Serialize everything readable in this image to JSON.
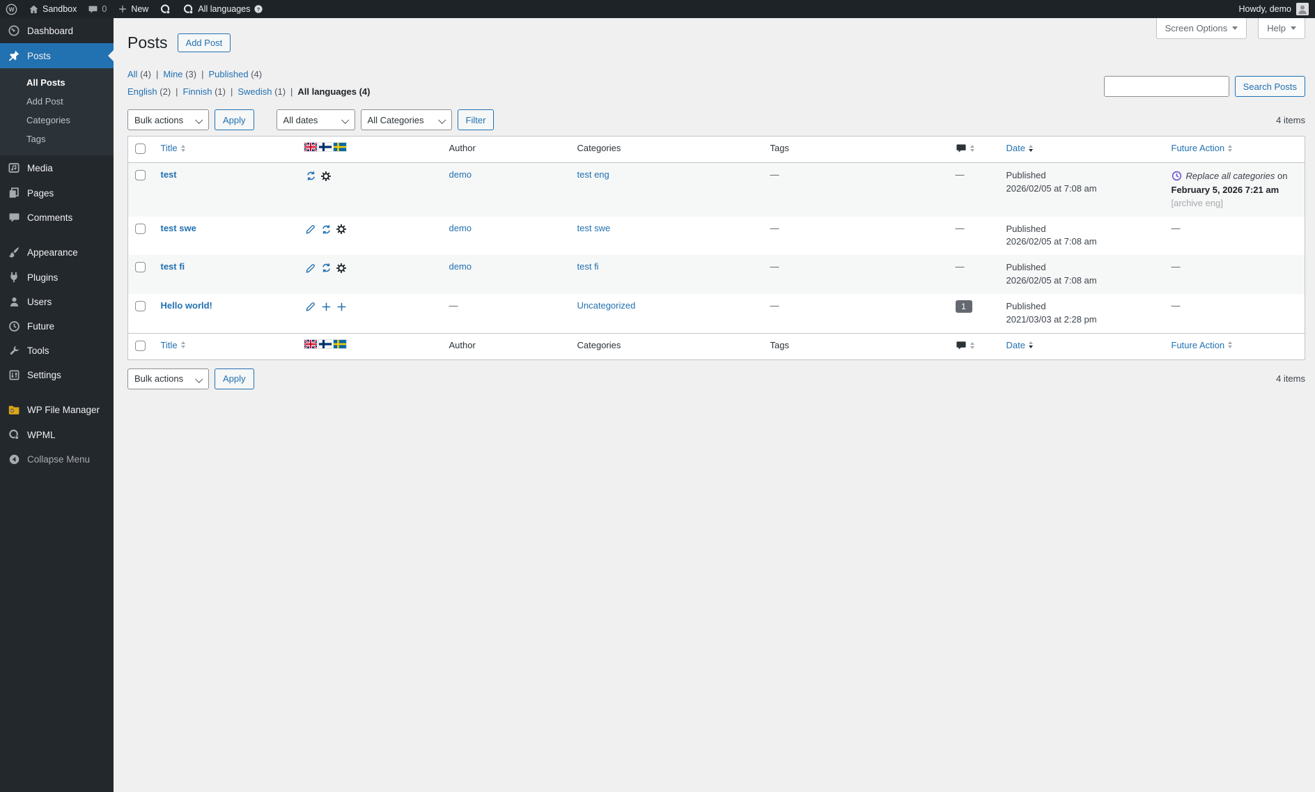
{
  "colors": {
    "admin_bar_bg": "#1d2327",
    "sidebar_bg": "#23282d",
    "submenu_bg": "#2c3338",
    "accent": "#2271b1",
    "page_bg": "#f0f0f1",
    "stripe": "#f6f7f7",
    "table_border": "#c3c4c7",
    "future_clock": "#6e56cf",
    "folder_orange": "#dba617"
  },
  "admin_bar": {
    "site_name": "Sandbox",
    "comment_count": "0",
    "new_label": "New",
    "language_selector": "All languages",
    "howdy": "Howdy, demo",
    "icons": [
      "wordpress-logo",
      "home-icon",
      "comments-bubble-icon",
      "plus-icon",
      "wpml-icon",
      "wpml-icon",
      "help-icon",
      "avatar"
    ]
  },
  "sidebar": {
    "items": [
      {
        "label": "Dashboard",
        "icon": "dashboard-gauge-icon"
      },
      {
        "label": "Posts",
        "icon": "pushpin-icon",
        "active": true,
        "submenu": [
          "All Posts",
          "Add Post",
          "Categories",
          "Tags"
        ],
        "current_submenu": "All Posts"
      },
      {
        "label": "Media",
        "icon": "media-icon"
      },
      {
        "label": "Pages",
        "icon": "pages-icon"
      },
      {
        "label": "Comments",
        "icon": "comment-bubble-icon"
      },
      {
        "label": "Appearance",
        "icon": "paintbrush-icon"
      },
      {
        "label": "Plugins",
        "icon": "plug-icon"
      },
      {
        "label": "Users",
        "icon": "person-icon"
      },
      {
        "label": "Future",
        "icon": "clock-icon"
      },
      {
        "label": "Tools",
        "icon": "wrench-icon"
      },
      {
        "label": "Settings",
        "icon": "sliders-icon"
      },
      {
        "label": "WP File Manager",
        "icon": "folder-icon"
      },
      {
        "label": "WPML",
        "icon": "wpml-globe-icon"
      },
      {
        "label": "Collapse Menu",
        "icon": "collapse-arrow-icon"
      }
    ]
  },
  "page": {
    "title": "Posts",
    "add_post": "Add Post",
    "screen_options": "Screen Options",
    "help": "Help"
  },
  "views": {
    "items": [
      {
        "label": "All",
        "count": "(4)"
      },
      {
        "label": "Mine",
        "count": "(3)"
      },
      {
        "label": "Published",
        "count": "(4)"
      }
    ]
  },
  "language_filters": {
    "items": [
      {
        "label": "English",
        "count": "(2)"
      },
      {
        "label": "Finnish",
        "count": "(1)"
      },
      {
        "label": "Swedish",
        "count": "(1)"
      },
      {
        "label": "All languages",
        "count": "(4)",
        "current": true
      }
    ]
  },
  "search": {
    "value": "",
    "button": "Search Posts"
  },
  "toolbar_top": {
    "bulk_actions": "Bulk actions",
    "apply": "Apply",
    "dates": "All dates",
    "categories": "All Categories",
    "filter": "Filter",
    "count": "4 items"
  },
  "toolbar_bottom": {
    "bulk_actions": "Bulk actions",
    "apply": "Apply",
    "count": "4 items"
  },
  "table": {
    "columns": {
      "title": "Title",
      "author": "Author",
      "categories": "Categories",
      "tags": "Tags",
      "date": "Date",
      "future_action": "Future Action"
    },
    "language_columns": [
      "English",
      "Finnish",
      "Swedish"
    ],
    "sort": {
      "date_direction": "desc"
    },
    "rows": [
      {
        "title": "test",
        "lang_actions": [
          "sync",
          "gear",
          ""
        ],
        "author": "demo",
        "categories": "test eng",
        "tags": "—",
        "comments": "—",
        "status": "Published",
        "date": "2026/02/05 at 7:08 am",
        "future_action": {
          "label": "Replace all categories",
          "connector": "on",
          "date": "February 5, 2026 7:21 am",
          "note": "[archive eng]"
        }
      },
      {
        "title": "test swe",
        "lang_actions": [
          "edit",
          "sync",
          "gear"
        ],
        "author": "demo",
        "categories": "test swe",
        "tags": "—",
        "comments": "—",
        "status": "Published",
        "date": "2026/02/05 at 7:08 am",
        "future_action": "—"
      },
      {
        "title": "test fi",
        "lang_actions": [
          "edit",
          "sync",
          "gear"
        ],
        "author": "demo",
        "categories": "test fi",
        "tags": "—",
        "comments": "—",
        "status": "Published",
        "date": "2026/02/05 at 7:08 am",
        "future_action": "—"
      },
      {
        "title": "Hello world!",
        "lang_actions": [
          "edit",
          "add",
          "add"
        ],
        "author": "—",
        "categories": "Uncategorized",
        "tags": "—",
        "comments": "1",
        "status": "Published",
        "date": "2021/03/03 at 2:28 pm",
        "future_action": "—"
      }
    ]
  }
}
